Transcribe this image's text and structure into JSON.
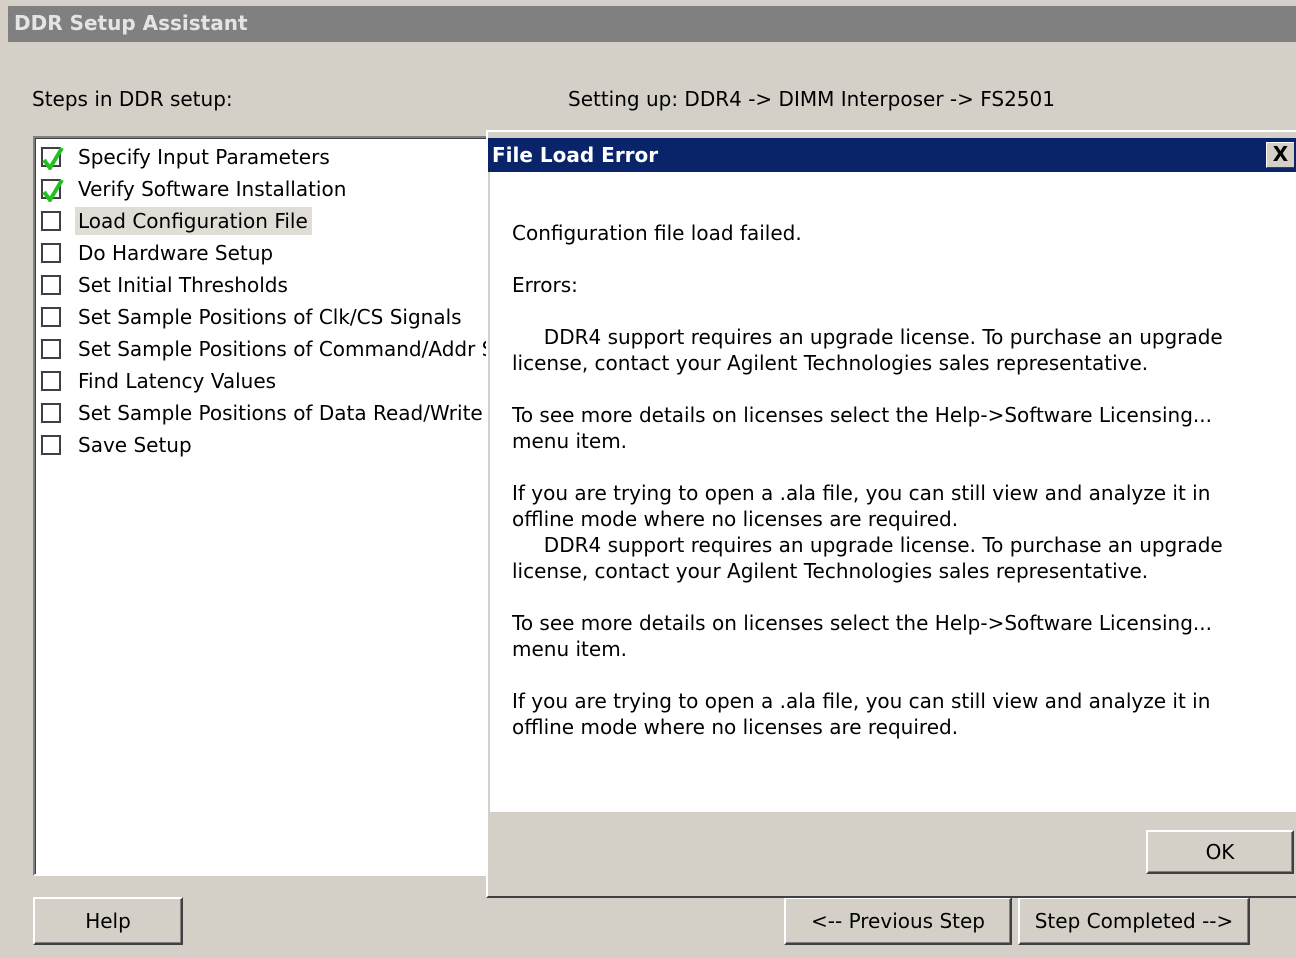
{
  "window": {
    "title": "DDR Setup Assistant"
  },
  "steps_label": "Steps in DDR setup:",
  "setup_label": "Setting up: DDR4 -> DIMM Interposer -> FS2501",
  "steps": [
    {
      "label": "Specify Input Parameters",
      "checked": true
    },
    {
      "label": "Verify Software Installation",
      "checked": true
    },
    {
      "label": "Load Configuration File",
      "checked": false,
      "selected": true
    },
    {
      "label": "Do Hardware Setup",
      "checked": false
    },
    {
      "label": "Set Initial Thresholds",
      "checked": false
    },
    {
      "label": "Set Sample Positions of Clk/CS Signals",
      "checked": false
    },
    {
      "label": "Set Sample Positions of Command/Addr Sig",
      "checked": false
    },
    {
      "label": "Find Latency Values",
      "checked": false
    },
    {
      "label": "Set Sample Positions of Data Read/Write",
      "checked": false
    },
    {
      "label": "Save Setup",
      "checked": false
    }
  ],
  "buttons": {
    "help": "Help",
    "previous": "<-- Previous Step",
    "completed": "Step Completed -->"
  },
  "dialog": {
    "title": "File Load Error",
    "close": "X",
    "messages": {
      "failed": "Configuration file load failed.",
      "errors_header": "Errors:",
      "license_1": "     DDR4 support requires an upgrade license. To purchase an upgrade license, contact your Agilent Technologies sales representative.",
      "details_1": "To see more details on licenses select the Help->Software Licensing... menu item.",
      "offline_1": "If you are trying to open a .ala file, you can still view and analyze it in offline mode where no licenses are required.",
      "license_2": "     DDR4 support requires an upgrade license. To purchase an upgrade license, contact your Agilent Technologies sales representative.",
      "details_2": "To see more details on licenses select the Help->Software Licensing... menu item.",
      "offline_2": "If you are trying to open a .ala file, you can still view and analyze it in offline mode where no licenses are required."
    },
    "ok": "OK"
  },
  "colors": {
    "dialog_title_bg": "#0a246a",
    "window_title_bg": "#808080",
    "check_green": "#22c122"
  }
}
